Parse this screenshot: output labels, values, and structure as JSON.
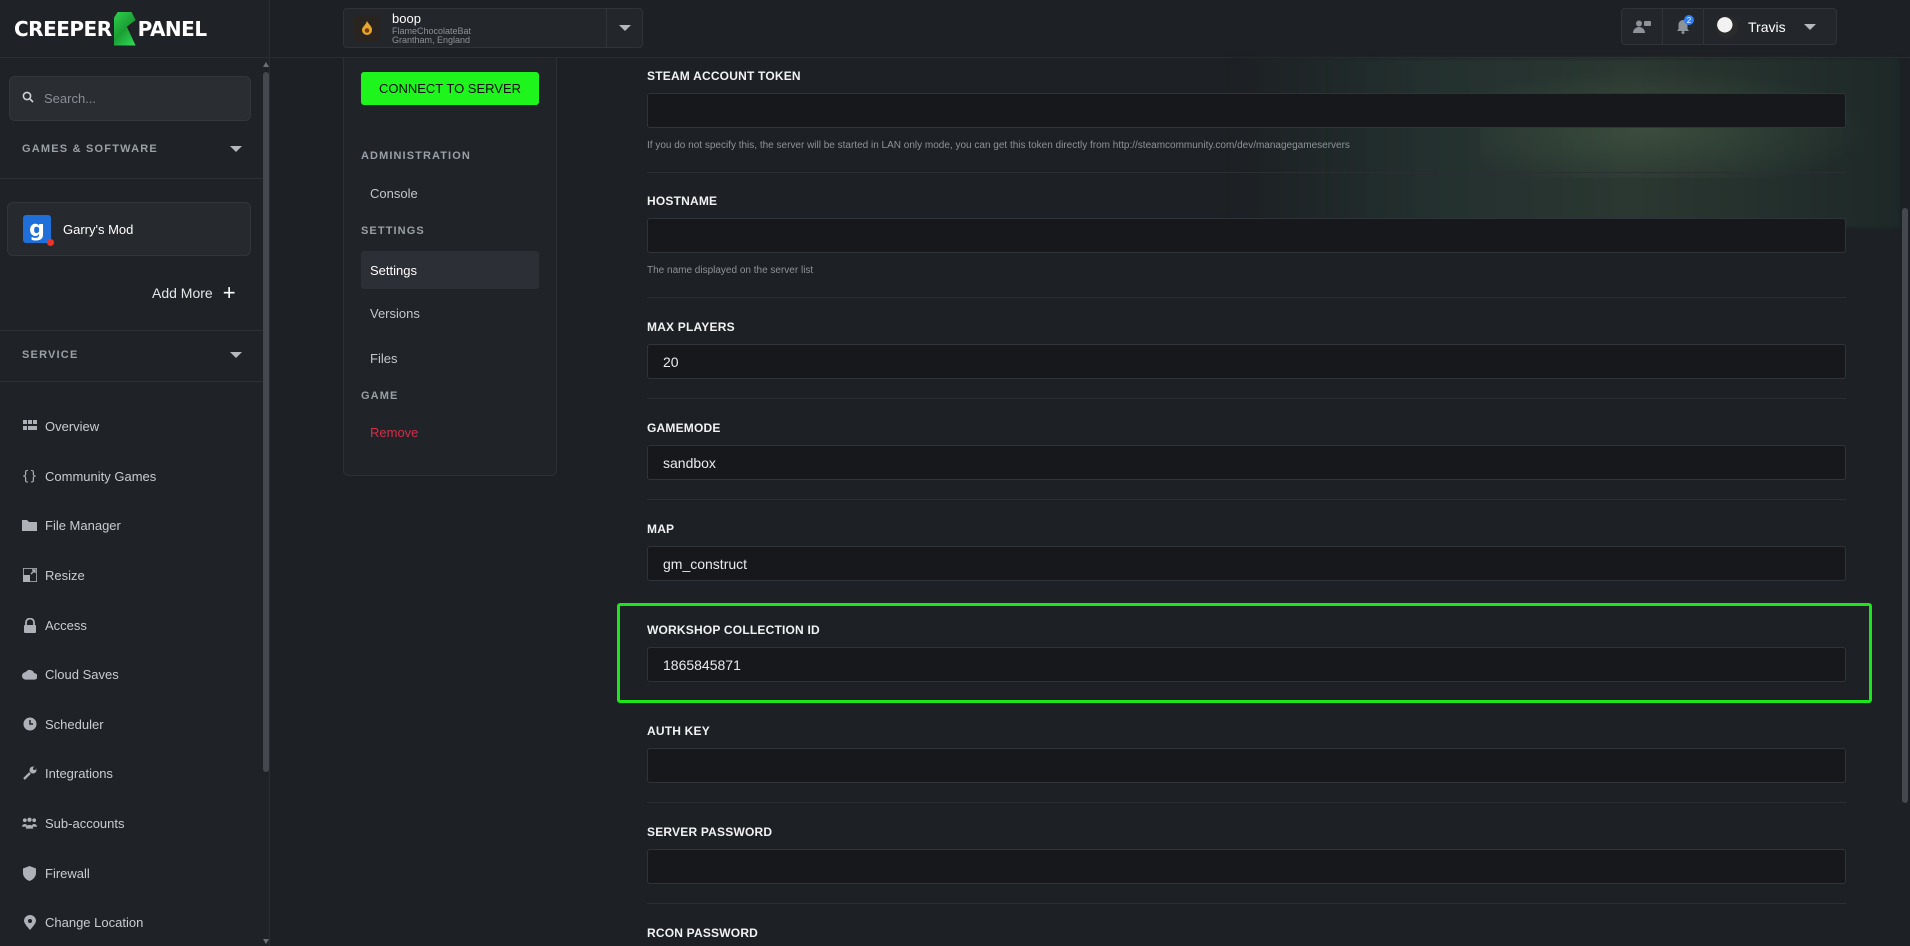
{
  "brand": {
    "left": "CREEPER",
    "right": "PANEL"
  },
  "sidebar": {
    "search_placeholder": "Search...",
    "games_section_label": "GAMES & SOFTWARE",
    "game_card": {
      "icon_letter": "g",
      "name": "Garry's Mod"
    },
    "add_more_label": "Add More",
    "service_section_label": "SERVICE",
    "nav": [
      {
        "label": "Overview",
        "icon": "grid-icon"
      },
      {
        "label": "Community Games",
        "icon": "braces-icon"
      },
      {
        "label": "File Manager",
        "icon": "folder-icon"
      },
      {
        "label": "Resize",
        "icon": "resize-icon"
      },
      {
        "label": "Access",
        "icon": "lock-icon"
      },
      {
        "label": "Cloud Saves",
        "icon": "cloud-icon"
      },
      {
        "label": "Scheduler",
        "icon": "clock-icon"
      },
      {
        "label": "Integrations",
        "icon": "wrench-icon"
      },
      {
        "label": "Sub-accounts",
        "icon": "users-icon"
      },
      {
        "label": "Firewall",
        "icon": "shield-icon"
      },
      {
        "label": "Change Location",
        "icon": "location-pin-icon"
      }
    ]
  },
  "topbar": {
    "server_name": "boop",
    "server_line1": "FlameChocolateBat",
    "server_line2": "Grantham, England",
    "notification_count": "2",
    "user_name": "Travis"
  },
  "subnav": {
    "connect_label": "CONNECT TO SERVER",
    "administration_label": "ADMINISTRATION",
    "console_label": "Console",
    "settings_section_label": "SETTINGS",
    "settings_label": "Settings",
    "versions_label": "Versions",
    "files_label": "Files",
    "game_section_label": "GAME",
    "remove_label": "Remove"
  },
  "form": {
    "steam_token": {
      "label": "STEAM ACCOUNT TOKEN",
      "value": "",
      "help": "If you do not specify this, the server will be started in LAN only mode, you can get this token directly from http://steamcommunity.com/dev/managegameservers"
    },
    "hostname": {
      "label": "HOSTNAME",
      "value": "",
      "help": "The name displayed on the server list"
    },
    "max_players": {
      "label": "MAX PLAYERS",
      "value": "20"
    },
    "gamemode": {
      "label": "GAMEMODE",
      "value": "sandbox"
    },
    "map": {
      "label": "MAP",
      "value": "gm_construct"
    },
    "workshop": {
      "label": "WORKSHOP COLLECTION ID",
      "value": "1865845871"
    },
    "auth_key": {
      "label": "AUTH KEY",
      "value": ""
    },
    "server_password": {
      "label": "SERVER PASSWORD",
      "value": ""
    },
    "rcon_password": {
      "label": "RCON PASSWORD"
    }
  },
  "colors": {
    "accent_green": "#1df51d",
    "highlight_green": "#1ce51c",
    "danger": "#d62e4a",
    "notification_blue": "#2f7ef5"
  }
}
